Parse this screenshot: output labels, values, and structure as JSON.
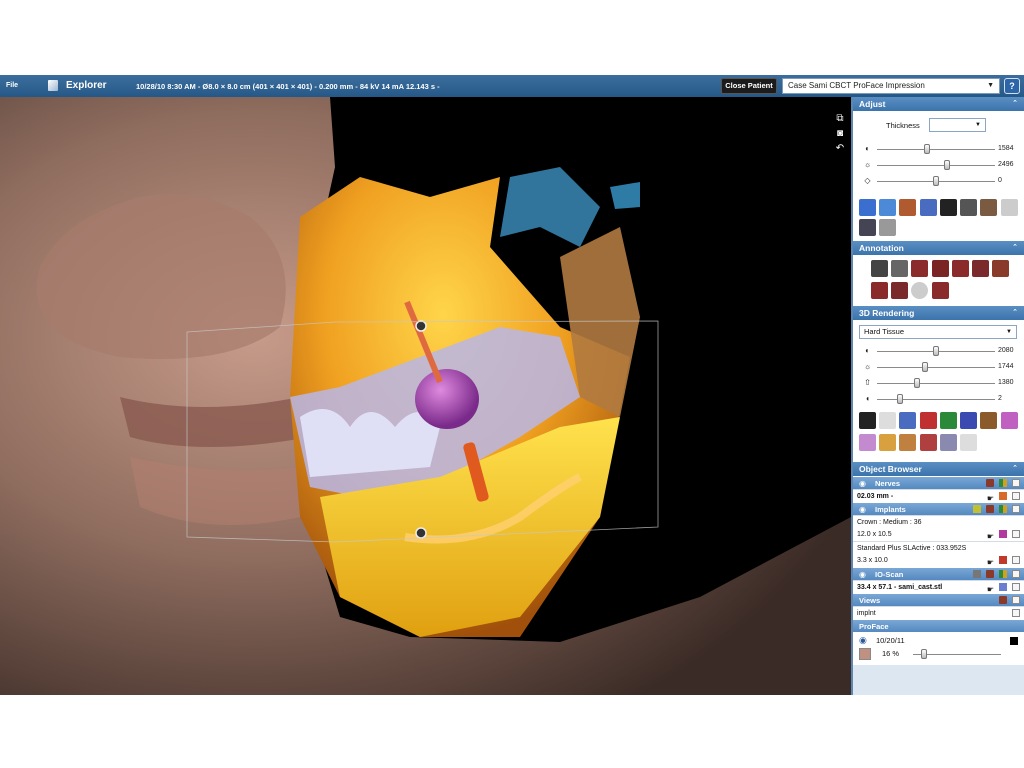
{
  "topbar": {
    "file": "File",
    "explorer": "Explorer",
    "info": "10/28/10 8:30 AM - Ø8.0 × 8.0 cm (401 × 401 × 401) - 0.200 mm - 84 kV 14 mA 12.143 s -",
    "close_patient": "Close Patient",
    "case": "Case Sami  CBCT ProFace Impression",
    "help": "?"
  },
  "adjust": {
    "title": "Adjust",
    "thickness_label": "Thickness",
    "thickness_value": "",
    "sliders": [
      {
        "icon": "contrast-icon",
        "glyph": "◐",
        "value": "1584",
        "level": 0.42
      },
      {
        "icon": "brightness-icon",
        "glyph": "☼",
        "value": "2496",
        "level": 0.6
      },
      {
        "icon": "gamma-icon",
        "glyph": "◇",
        "value": "0",
        "level": 0.5
      }
    ]
  },
  "annotation": {
    "title": "Annotation"
  },
  "rendering": {
    "title": "3D Rendering",
    "mode": "Hard Tissue",
    "sliders": [
      {
        "icon": "contrast-icon",
        "glyph": "◐",
        "value": "2080",
        "level": 0.5
      },
      {
        "icon": "brightness-icon",
        "glyph": "☼",
        "value": "1744",
        "level": 0.4
      },
      {
        "icon": "opacity-icon",
        "glyph": "⇧",
        "value": "1380",
        "level": 0.33
      },
      {
        "icon": "smoothing-icon",
        "glyph": "◖",
        "value": "2",
        "level": 0.18
      }
    ]
  },
  "object_browser": {
    "title": "Object Browser",
    "nerves": {
      "label": "Nerves",
      "item": "02.03 mm -"
    },
    "implants": {
      "label": "Implants",
      "crown": "Crown : Medium : 36",
      "crown_size": "12.0 x 10.5",
      "implant": "Standard Plus SLActive : 033.952S",
      "implant_size": "3.3 x 10.0"
    },
    "ioscan": {
      "label": "IO-Scan",
      "item": "33.4 x 57.1 - sami_cast.stl"
    },
    "views": {
      "label": "Views",
      "item": "implnt"
    },
    "proface": {
      "label": "ProFace",
      "date": "10/20/11",
      "opacity": "16 %",
      "level": 0.1
    }
  },
  "colors": {
    "accent": "#3b73ab",
    "panel_bg": "#dce7f1",
    "title_bar": "#265887"
  }
}
